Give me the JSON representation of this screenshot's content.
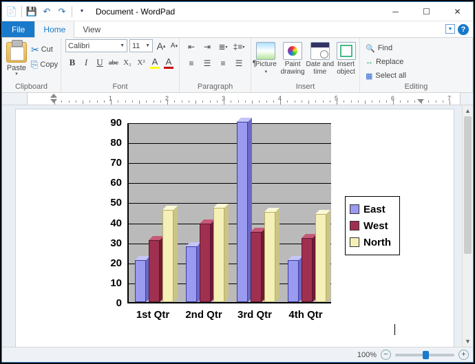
{
  "title": "Document - WordPad",
  "qat": {
    "save": "💾",
    "undo": "↶",
    "redo": "↷"
  },
  "tabs": {
    "file": "File",
    "home": "Home",
    "view": "View"
  },
  "ribbon": {
    "clipboard": {
      "label": "Clipboard",
      "paste": "Paste",
      "cut": "Cut",
      "copy": "Copy"
    },
    "font": {
      "label": "Font",
      "name": "Calibri",
      "size": "11",
      "grow": "A",
      "shrink": "A",
      "bold": "B",
      "italic": "I",
      "underline": "U",
      "strike": "abc",
      "sub": "X₂",
      "sup": "X²",
      "pen": "A",
      "color": "A"
    },
    "paragraph": {
      "label": "Paragraph"
    },
    "insert": {
      "label": "Insert",
      "picture": "Picture",
      "paint": "Paint\ndrawing",
      "date": "Date and\ntime",
      "object": "Insert\nobject"
    },
    "editing": {
      "label": "Editing",
      "find": "Find",
      "replace": "Replace",
      "selectall": "Select all"
    }
  },
  "ruler_numbers": [
    "1",
    "2",
    "3",
    "4",
    "5",
    "6",
    "7"
  ],
  "chart_data": {
    "type": "bar",
    "categories": [
      "1st Qtr",
      "2nd Qtr",
      "3rd Qtr",
      "4th Qtr"
    ],
    "series": [
      {
        "name": "East",
        "values": [
          21,
          28,
          90,
          21
        ]
      },
      {
        "name": "West",
        "values": [
          31,
          39,
          35,
          32
        ]
      },
      {
        "name": "North",
        "values": [
          46,
          47,
          45,
          44
        ]
      }
    ],
    "ylim": [
      0,
      90
    ],
    "yticks": [
      0,
      10,
      20,
      30,
      40,
      50,
      60,
      70,
      80,
      90
    ],
    "colors": {
      "East": "#9a9af0",
      "West": "#a03050",
      "North": "#f5f0b8"
    }
  },
  "status": {
    "zoom": "100%",
    "minus": "−",
    "plus": "+"
  }
}
